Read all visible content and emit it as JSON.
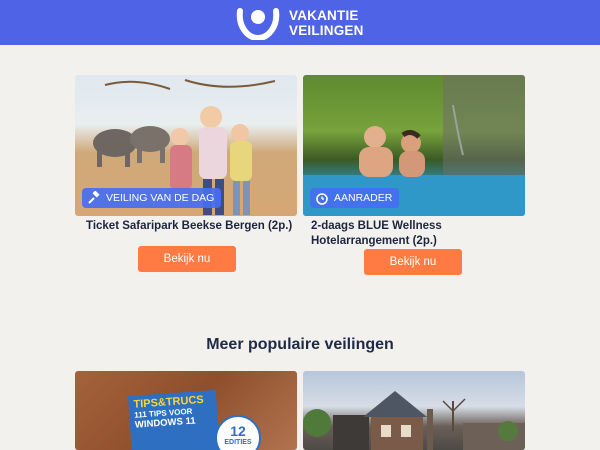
{
  "brand": {
    "line1": "VAKANTIE",
    "line2": "VEILINGEN"
  },
  "featured": [
    {
      "badge": "VEILING VAN DE DAG",
      "badge_icon": "gavel-icon",
      "title": "Ticket Safaripark Beekse Bergen (2p.)",
      "button": "Bekijk nu"
    },
    {
      "badge": "AANRADER",
      "badge_icon": "alarm-clock-icon",
      "title_line1": "2-daags BLUE Wellness",
      "title_line2": "Hotelarrangement (2p.)",
      "button": "Bekijk nu"
    }
  ],
  "section": {
    "title": "Meer populaire veilingen"
  },
  "popular": [
    {
      "cover_line1": "TIPS&TRUCS",
      "cover_line2": "111 TIPS VOOR",
      "cover_line3": "WINDOWS 11",
      "sticker_number": "12",
      "sticker_text": "EDITIES"
    },
    {
      "image": "house"
    }
  ],
  "colors": {
    "header": "#4e63e6",
    "button": "#ff7b43",
    "badge": "#466ef0",
    "background": "#f3f1ee"
  }
}
